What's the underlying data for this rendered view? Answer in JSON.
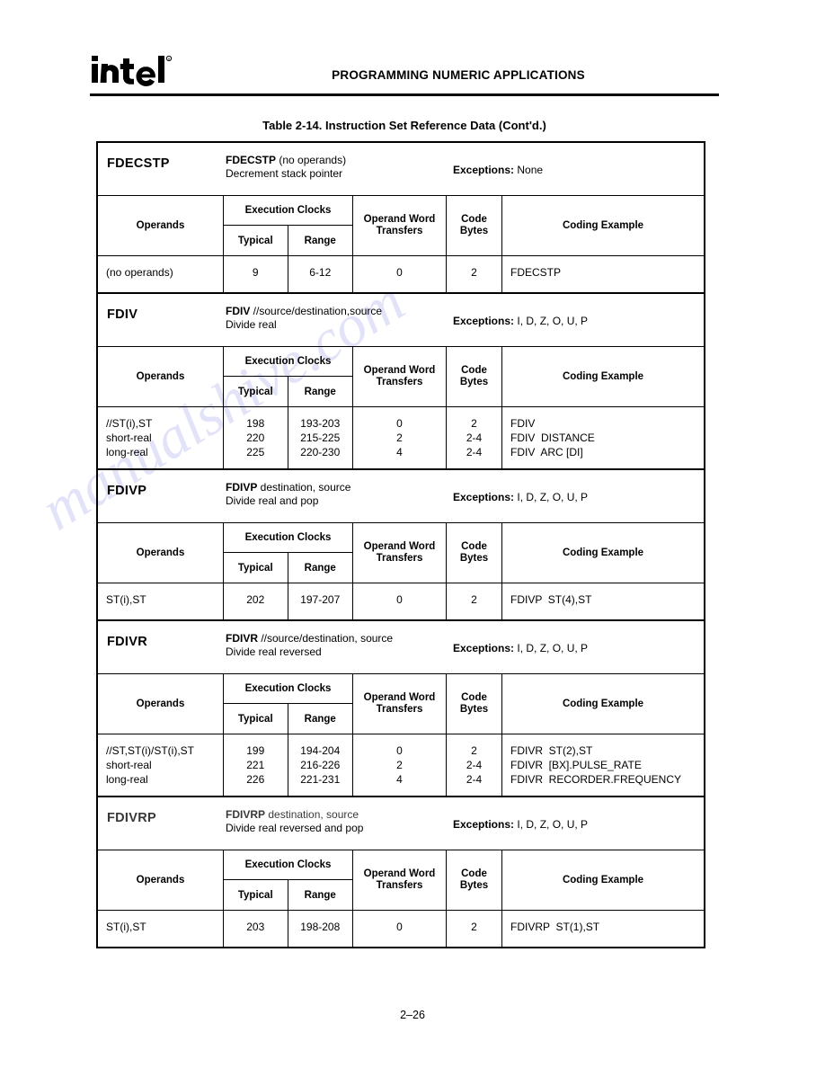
{
  "header": {
    "logo_text": "intel",
    "title": "PROGRAMMING NUMERIC APPLICATIONS"
  },
  "caption": "Table 2-14.  Instruction Set Reference Data (Cont'd.)",
  "page_number": "2–26",
  "watermark": "manualshive.com",
  "column_headers": {
    "operands": "Operands",
    "execution_clocks": "Execution Clocks",
    "typical": "Typical",
    "range": "Range",
    "operand_word_transfers": "Operand Word\nTransfers",
    "operand_word_transfers_l1": "Operand Word",
    "operand_word_transfers_l2": "Transfers",
    "code_bytes_l1": "Code",
    "code_bytes_l2": "Bytes",
    "coding_example": "Coding Example"
  },
  "exceptions_label": "Exceptions:",
  "blocks": [
    {
      "mnemonic": "FDECSTP",
      "syntax_mnemonic": "FDECSTP",
      "syntax_operands": " (no operands)",
      "description": "Decrement stack pointer",
      "exceptions": "None",
      "rows": [
        {
          "operands": "(no operands)",
          "typical": "9",
          "range": "6-12",
          "transfers": "0",
          "bytes": "2",
          "coding": "FDECSTP"
        }
      ]
    },
    {
      "mnemonic": "FDIV",
      "syntax_mnemonic": "FDIV",
      "syntax_operands": " //source/destination,source",
      "description": "Divide real",
      "exceptions": "I, D, Z, O, U, P",
      "rows": [
        {
          "operands": "//ST(i),ST\nshort-real\nlong-real",
          "typical": "198\n220\n225",
          "range": "193-203\n215-225\n220-230",
          "transfers": "0\n2\n4",
          "bytes": "2\n2-4\n2-4",
          "coding": "FDIV\nFDIV  DISTANCE\nFDIV  ARC [DI]"
        }
      ]
    },
    {
      "mnemonic": "FDIVP",
      "syntax_mnemonic": "FDIVP",
      "syntax_operands": " destination, source",
      "description": "Divide real and pop",
      "exceptions": "I, D, Z, O, U, P",
      "rows": [
        {
          "operands": "ST(i),ST",
          "typical": "202",
          "range": "197-207",
          "transfers": "0",
          "bytes": "2",
          "coding": "FDIVP  ST(4),ST"
        }
      ]
    },
    {
      "mnemonic": "FDIVR",
      "syntax_mnemonic": "FDIVR",
      "syntax_operands": " //source/destination, source",
      "description": "Divide real reversed",
      "exceptions": "I, D, Z, O, U, P",
      "rows": [
        {
          "operands": "//ST,ST(i)/ST(i),ST\nshort-real\nlong-real",
          "typical": "199\n221\n226",
          "range": "194-204\n216-226\n221-231",
          "transfers": "0\n2\n4",
          "bytes": "2\n2-4\n2-4",
          "coding": "FDIVR  ST(2),ST\nFDIVR  [BX].PULSE_RATE\nFDIVR  RECORDER.FREQUENCY"
        }
      ]
    },
    {
      "mnemonic": "FDIVRP",
      "syntax_mnemonic": "FDIVRP",
      "syntax_operands": " destination, source",
      "description": "Divide real reversed and pop",
      "exceptions": "I, D, Z, O, U, P",
      "rows": [
        {
          "operands": "ST(i),ST",
          "typical": "203",
          "range": "198-208",
          "transfers": "0",
          "bytes": "2",
          "coding": "FDIVRP  ST(1),ST"
        }
      ]
    }
  ]
}
